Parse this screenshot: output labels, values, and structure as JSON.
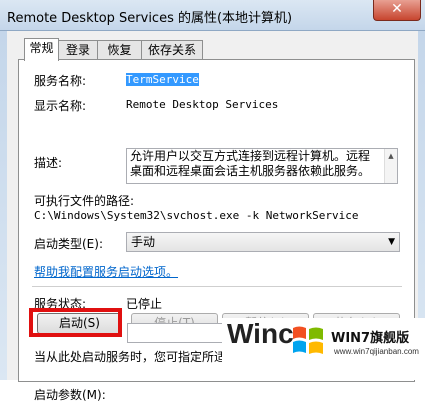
{
  "window": {
    "title": "Remote Desktop Services 的属性(本地计算机)",
    "close_glyph": "✕"
  },
  "tabs": [
    "常规",
    "登录",
    "恢复",
    "依存关系"
  ],
  "general": {
    "service_name_label": "服务名称:",
    "service_name_value": "TermService",
    "display_name_label": "显示名称:",
    "display_name_value": "Remote Desktop Services",
    "description_label": "描述:",
    "description_line1": "允许用户以交互方式连接到远程计算机。远程",
    "description_line2": "桌面和远程桌面会话主机服务器依赖此服务。",
    "exe_path_label": "可执行文件的路径:",
    "exe_path_value": "C:\\Windows\\System32\\svchost.exe -k NetworkService",
    "startup_type_label": "启动类型(E):",
    "startup_type_value": "手动",
    "help_link": "帮助我配置服务启动选项。",
    "status_label": "服务状态:",
    "status_value": "已停止",
    "buttons": {
      "start": "启动(S)",
      "stop": "停止(T)",
      "pause": "暂停(P)",
      "resume": "恢复(R)"
    },
    "hint_text": "当从此处启动服务时，您可指定所适用的启动参数。",
    "start_params_label": "启动参数(M):"
  },
  "watermark": {
    "win_text": "Winc",
    "brand": "WIN7旗舰版",
    "url": "www.win7qijianban.com"
  },
  "colors": {
    "highlight": "#3399ff",
    "link": "#0066cc",
    "red_box": "#e01010"
  }
}
